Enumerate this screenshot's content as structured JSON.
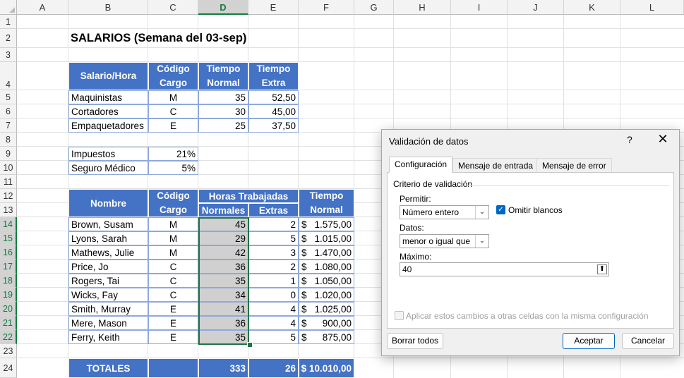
{
  "columns": [
    "A",
    "B",
    "C",
    "D",
    "E",
    "F",
    "G",
    "H",
    "I",
    "J",
    "K",
    "L"
  ],
  "rows": [
    "1",
    "2",
    "3",
    "4",
    "5",
    "6",
    "7",
    "8",
    "9",
    "10",
    "11",
    "12",
    "13",
    "14",
    "15",
    "16",
    "17",
    "18",
    "19",
    "20",
    "21",
    "22",
    "23",
    "24"
  ],
  "sheet": {
    "title": "SALARIOS (Semana del 03-sep)",
    "rate_table": {
      "headers": [
        "Salario/Hora",
        "Código Cargo",
        "Tiempo Normal",
        "Tiempo Extra"
      ],
      "rows": [
        [
          "Maquinistas",
          "M",
          "35",
          "52,50"
        ],
        [
          "Cortadores",
          "C",
          "30",
          "45,00"
        ],
        [
          "Empaquetadores",
          "E",
          "25",
          "37,50"
        ]
      ]
    },
    "taxes": [
      [
        "Impuestos",
        "21%"
      ],
      [
        "Seguro Médico",
        "5%"
      ]
    ],
    "main_table": {
      "h_nombre": "Nombre",
      "h_codigo": "Código Cargo",
      "h_horas": "Horas Trabajadas",
      "h_normales": "Normales",
      "h_extras": "Extras",
      "h_tiempo": "Tiempo Normal",
      "currency": "$",
      "rows": [
        [
          "Brown, Susam",
          "M",
          "45",
          "2",
          "1.575,00"
        ],
        [
          "Lyons, Sarah",
          "M",
          "29",
          "5",
          "1.015,00"
        ],
        [
          "Mathews, Julie",
          "M",
          "42",
          "3",
          "1.470,00"
        ],
        [
          "Price, Jo",
          "C",
          "36",
          "2",
          "1.080,00"
        ],
        [
          "Rogers, Tai",
          "C",
          "35",
          "1",
          "1.050,00"
        ],
        [
          "Wicks, Fay",
          "C",
          "34",
          "0",
          "1.020,00"
        ],
        [
          "Smith, Murray",
          "E",
          "41",
          "4",
          "1.025,00"
        ],
        [
          "Mere, Mason",
          "E",
          "36",
          "4",
          "900,00"
        ],
        [
          "Ferry, Keith",
          "E",
          "35",
          "5",
          "875,00"
        ]
      ],
      "totals": [
        "TOTALES",
        "333",
        "26",
        "$ 10.010,00"
      ]
    }
  },
  "dialog": {
    "title": "Validación de datos",
    "help": "?",
    "close": "✕",
    "tabs": [
      "Configuración",
      "Mensaje de entrada",
      "Mensaje de error"
    ],
    "section": "Criterio de validación",
    "permitir_label": "Permitir:",
    "permitir_value": "Número entero",
    "omitir_label": "Omitir blancos",
    "datos_label": "Datos:",
    "datos_value": "menor o igual que",
    "maximo_label": "Máximo:",
    "maximo_value": "40",
    "apply_label": "Aplicar estos cambios a otras celdas con la misma configuración",
    "clear_button": "Borrar todos",
    "ok_button": "Aceptar",
    "cancel_button": "Cancelar"
  }
}
